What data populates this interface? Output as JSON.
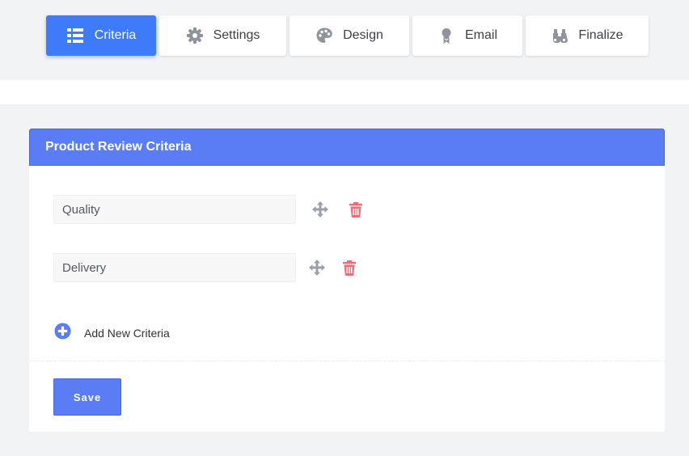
{
  "tabs": [
    {
      "label": "Criteria",
      "icon": "list-icon",
      "active": true
    },
    {
      "label": "Settings",
      "icon": "gear-icon",
      "active": false
    },
    {
      "label": "Design",
      "icon": "palette-icon",
      "active": false
    },
    {
      "label": "Email",
      "icon": "award-ribbon-icon",
      "active": false
    },
    {
      "label": "Finalize",
      "icon": "binoculars-icon",
      "active": false
    }
  ],
  "panel": {
    "title": "Product Review Criteria",
    "criteria": [
      {
        "value": "Quality"
      },
      {
        "value": "Delivery"
      }
    ],
    "add_label": "Add New Criteria",
    "save_label": "Save"
  },
  "colors": {
    "accent": "#3e7bfa",
    "panel_header": "#5a7df6",
    "delete": "#e8707a",
    "move": "#9aa0ab",
    "background": "#f2f3f5"
  }
}
